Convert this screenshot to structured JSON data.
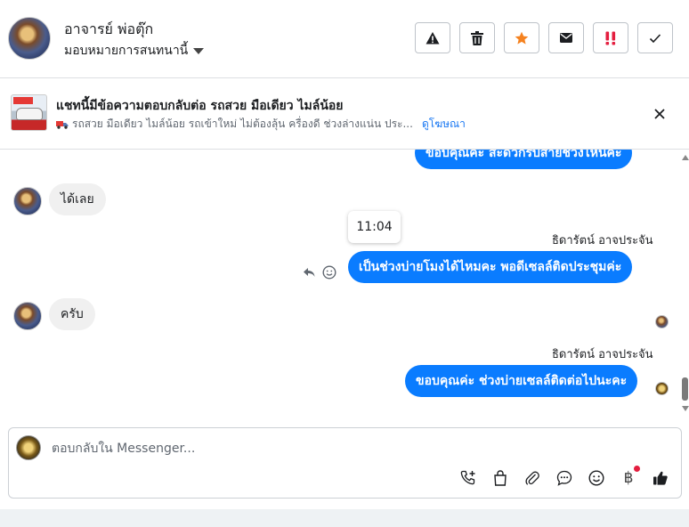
{
  "header": {
    "name": "อาจารย์ พ่อตุ๊ก",
    "assign_label": "มอบหมายการสนทนานี้",
    "actions": [
      {
        "name": "spam-report-button",
        "icon": "warning-icon"
      },
      {
        "name": "delete-button",
        "icon": "trash-icon"
      },
      {
        "name": "star-button",
        "icon": "star-icon",
        "color": "#f5821f"
      },
      {
        "name": "mark-unread-button",
        "icon": "envelope-icon"
      },
      {
        "name": "follow-up-button",
        "icon": "double-exclamation-icon",
        "color": "#e41e3f"
      },
      {
        "name": "mark-done-button",
        "icon": "check-icon"
      }
    ]
  },
  "ad": {
    "title": "แชทนี้มีข้อความตอบกลับต่อ รถสวย มือเดียว ไมล์น้อย",
    "subtitle": "รถสวย มือเดียว ไมล์น้อย รถเข้าใหม่ ไม่ต้องลุ้น ครื่องดี ช่วงล่างแน่น ประ...",
    "link": "ดูโฆษณา"
  },
  "messages": {
    "out1": "ขอบคุณค่ะ สะดวกรบสายช่วงไหนคะ",
    "in1": "ได้เลย",
    "timestamp": "11:04",
    "sender1": "ธิดารัตน์ อาจประจัน",
    "out2": "เป็นช่วงบ่ายโมงได้ไหมคะ พอดีเซลล์ติดประชุมค่ะ",
    "in2": "ครับ",
    "sender2": "ธิดารัตน์ อาจประจัน",
    "out3": "ขอบคุณค่ะ ช่วงบ่ายเซลล์ติดต่อไปนะคะ"
  },
  "composer": {
    "placeholder": "ตอบกลับใน Messenger...",
    "baht_symbol": "฿"
  },
  "colors": {
    "accent": "#0a7cff",
    "link": "#1877f2",
    "alert": "#e41e3f"
  }
}
